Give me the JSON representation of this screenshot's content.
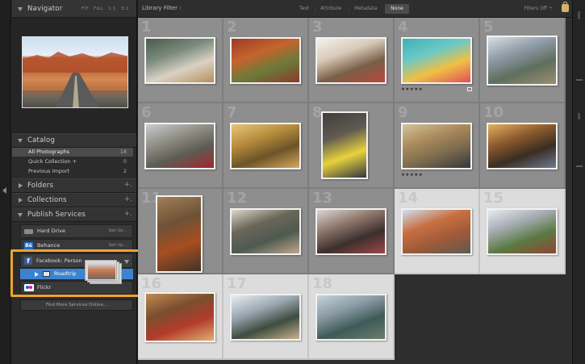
{
  "navigator": {
    "title": "Navigator",
    "zoom_options": [
      "FIT",
      "FILL",
      "1:1",
      "3:1"
    ]
  },
  "catalog": {
    "title": "Catalog",
    "items": [
      {
        "label": "All Photographs",
        "count": "18"
      },
      {
        "label": "Quick Collection +",
        "count": "0"
      },
      {
        "label": "Previous Import",
        "count": "2"
      }
    ]
  },
  "folders": {
    "title": "Folders",
    "plus": "+."
  },
  "collections": {
    "title": "Collections",
    "plus": "+."
  },
  "publish": {
    "title": "Publish Services",
    "plus": "+.",
    "services": [
      {
        "label": "Hard Drive",
        "action": "Set Up...",
        "icon_color": "#8a8a8a"
      },
      {
        "label": "Behance",
        "action": "Set Up...",
        "icon_color": "#1b6ed1",
        "icon_text": "Bē"
      },
      {
        "label": "Facebook: Person",
        "icon_color": "#3b5a98",
        "icon_text": "f"
      },
      {
        "label": "Flickr",
        "icon_color": "#ffffff"
      }
    ],
    "facebook_sub": "Roadtrip",
    "find_more": "Find More Services Online..."
  },
  "filter_bar": {
    "title": "Library Filter :",
    "options": [
      "Text",
      "Attribute",
      "Metadata"
    ],
    "selected": "None",
    "filters_off": "Filters Off ÷"
  },
  "grid": {
    "cells": [
      {
        "num": "1",
        "colors": [
          "#4a5a4a",
          "#7a8a7c",
          "#d9d2c4",
          "#b68f5a"
        ]
      },
      {
        "num": "2",
        "colors": [
          "#9c3b25",
          "#c5642d",
          "#6b7a3a",
          "#8c3a2a"
        ]
      },
      {
        "num": "3",
        "colors": [
          "#f4f2ee",
          "#d7c9b6",
          "#7a5f49",
          "#b9463b"
        ]
      },
      {
        "num": "4",
        "colors": [
          "#3fb0b7",
          "#6cc9c4",
          "#f0c042",
          "#e04f5b"
        ],
        "rating": "★★★★★"
      },
      {
        "num": "5",
        "colors": [
          "#d9dee3",
          "#8e9aa5",
          "#5d6f5e",
          "#9c8e6d"
        ]
      },
      {
        "num": "6",
        "colors": [
          "#c9ccd0",
          "#8f8f86",
          "#5c5c54",
          "#a6262e"
        ]
      },
      {
        "num": "7",
        "colors": [
          "#e8c57a",
          "#b78c3c",
          "#6c5428",
          "#d6a95b"
        ]
      },
      {
        "num": "8",
        "colors": [
          "#3f3d3a",
          "#5f5a52",
          "#e7d23b",
          "#2e3440"
        ]
      },
      {
        "num": "9",
        "colors": [
          "#d4c39c",
          "#ab8a5c",
          "#7a6a4d",
          "#34373d"
        ],
        "rating": "★★★★★"
      },
      {
        "num": "10",
        "colors": [
          "#e4b25b",
          "#8b5a2e",
          "#3a2d22",
          "#6e7b95"
        ]
      },
      {
        "num": "11",
        "colors": [
          "#a38057",
          "#6d5236",
          "#a74d21",
          "#3e3428"
        ]
      },
      {
        "num": "12",
        "colors": [
          "#dfd6c8",
          "#6a6658",
          "#4e5a50",
          "#c1a88a"
        ]
      },
      {
        "num": "13",
        "colors": [
          "#ddd8d2",
          "#8d756a",
          "#3c2f2d",
          "#a04747"
        ]
      },
      {
        "num": "14",
        "colors": [
          "#cde0f0",
          "#c86f41",
          "#9f5a38",
          "#5b5a55"
        ]
      },
      {
        "num": "15",
        "colors": [
          "#e9ecee",
          "#a3aab0",
          "#5a7a42",
          "#8f4434"
        ]
      },
      {
        "num": "16",
        "colors": [
          "#c28a54",
          "#7a4f2e",
          "#b33b2c",
          "#e0b170"
        ]
      },
      {
        "num": "17",
        "colors": [
          "#e9eef2",
          "#9ba8b1",
          "#3e4c3f",
          "#c9b18f"
        ]
      },
      {
        "num": "18",
        "colors": [
          "#c4d3dd",
          "#8a9aa3",
          "#3e5a58",
          "#6d7e6e"
        ]
      }
    ]
  },
  "colors": {
    "highlight": "#f0a230",
    "selection": "#3a83cf"
  }
}
